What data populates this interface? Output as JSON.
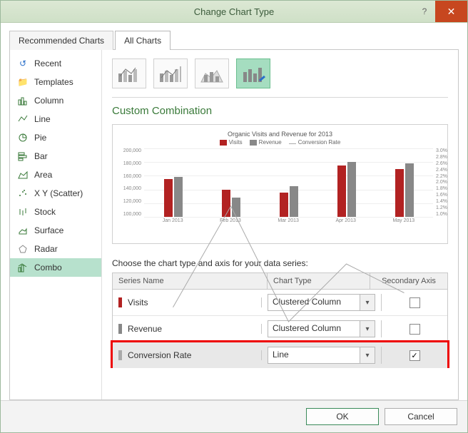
{
  "title": "Change Chart Type",
  "tabs": {
    "recommended": "Recommended Charts",
    "all": "All Charts"
  },
  "sidebar": {
    "items": [
      {
        "label": "Recent"
      },
      {
        "label": "Templates"
      },
      {
        "label": "Column"
      },
      {
        "label": "Line"
      },
      {
        "label": "Pie"
      },
      {
        "label": "Bar"
      },
      {
        "label": "Area"
      },
      {
        "label": "X Y (Scatter)"
      },
      {
        "label": "Stock"
      },
      {
        "label": "Surface"
      },
      {
        "label": "Radar"
      },
      {
        "label": "Combo"
      }
    ]
  },
  "heading": "Custom Combination",
  "preview": {
    "title": "Organic Visits and Revenue for 2013",
    "legend": {
      "visits": "Visits",
      "revenue": "Revenue",
      "cr": "Conversion Rate"
    },
    "y_left": [
      "200,000",
      "180,000",
      "160,000",
      "140,000",
      "120,000",
      "100,000"
    ],
    "y_right": [
      "3.0%",
      "2.8%",
      "2.6%",
      "2.4%",
      "2.2%",
      "2.0%",
      "1.8%",
      "1.6%",
      "1.4%",
      "1.2%",
      "1.0%"
    ],
    "x": [
      "Jan 2013",
      "Feb 2013",
      "Mar 2013",
      "Apr 2013",
      "May 2013"
    ]
  },
  "series_instruction": "Choose the chart type and axis for your data series:",
  "table_head": {
    "name": "Series Name",
    "type": "Chart Type",
    "axis": "Secondary Axis"
  },
  "series": [
    {
      "name": "Visits",
      "type": "Clustered Column",
      "axis": false,
      "color": "#b22222"
    },
    {
      "name": "Revenue",
      "type": "Clustered Column",
      "axis": false,
      "color": "#888"
    },
    {
      "name": "Conversion Rate",
      "type": "Line",
      "axis": true,
      "color": "#aaa"
    }
  ],
  "buttons": {
    "ok": "OK",
    "cancel": "Cancel"
  },
  "chart_data": {
    "type": "bar",
    "title": "Organic Visits and Revenue for 2013",
    "categories": [
      "Jan 2013",
      "Feb 2013",
      "Mar 2013",
      "Apr 2013",
      "May 2013"
    ],
    "series": [
      {
        "name": "Visits",
        "type": "clustered_column",
        "axis": "primary",
        "values": [
          155000,
          140000,
          135000,
          175000,
          170000
        ]
      },
      {
        "name": "Revenue",
        "type": "clustered_column",
        "axis": "primary",
        "values": [
          158000,
          128000,
          145000,
          180000,
          178000
        ]
      },
      {
        "name": "Conversion Rate",
        "type": "line",
        "axis": "secondary",
        "values": [
          1.9,
          2.6,
          1.8,
          2.2,
          2.0
        ]
      }
    ],
    "ylabel": "",
    "ylim": [
      100000,
      200000
    ],
    "y2label": "",
    "y2lim": [
      1.0,
      3.0
    ]
  }
}
